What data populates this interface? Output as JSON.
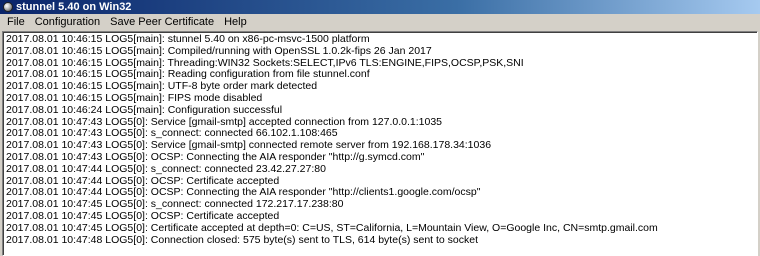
{
  "window": {
    "title": "stunnel 5.40 on Win32"
  },
  "menu": {
    "items": [
      "File",
      "Configuration",
      "Save Peer Certificate",
      "Help"
    ]
  },
  "log": {
    "lines": [
      "2017.08.01 10:46:15 LOG5[main]: stunnel 5.40 on x86-pc-msvc-1500 platform",
      "2017.08.01 10:46:15 LOG5[main]: Compiled/running with OpenSSL 1.0.2k-fips  26 Jan 2017",
      "2017.08.01 10:46:15 LOG5[main]: Threading:WIN32 Sockets:SELECT,IPv6 TLS:ENGINE,FIPS,OCSP,PSK,SNI",
      "2017.08.01 10:46:15 LOG5[main]: Reading configuration from file stunnel.conf",
      "2017.08.01 10:46:15 LOG5[main]: UTF-8 byte order mark detected",
      "2017.08.01 10:46:15 LOG5[main]: FIPS mode disabled",
      "2017.08.01 10:46:24 LOG5[main]: Configuration successful",
      "2017.08.01 10:47:43 LOG5[0]: Service [gmail-smtp] accepted connection from 127.0.0.1:1035",
      "2017.08.01 10:47:43 LOG5[0]: s_connect: connected 66.102.1.108:465",
      "2017.08.01 10:47:43 LOG5[0]: Service [gmail-smtp] connected remote server from 192.168.178.34:1036",
      "2017.08.01 10:47:43 LOG5[0]: OCSP: Connecting the AIA responder \"http://g.symcd.com\"",
      "2017.08.01 10:47:44 LOG5[0]: s_connect: connected 23.42.27.27:80",
      "2017.08.01 10:47:44 LOG5[0]: OCSP: Certificate accepted",
      "2017.08.01 10:47:44 LOG5[0]: OCSP: Connecting the AIA responder \"http://clients1.google.com/ocsp\"",
      "2017.08.01 10:47:45 LOG5[0]: s_connect: connected 172.217.17.238:80",
      "2017.08.01 10:47:45 LOG5[0]: OCSP: Certificate accepted",
      "2017.08.01 10:47:45 LOG5[0]: Certificate accepted at depth=0: C=US, ST=California, L=Mountain View, O=Google Inc, CN=smtp.gmail.com",
      "2017.08.01 10:47:48 LOG5[0]: Connection closed: 575 byte(s) sent to TLS, 614 byte(s) sent to socket"
    ]
  }
}
